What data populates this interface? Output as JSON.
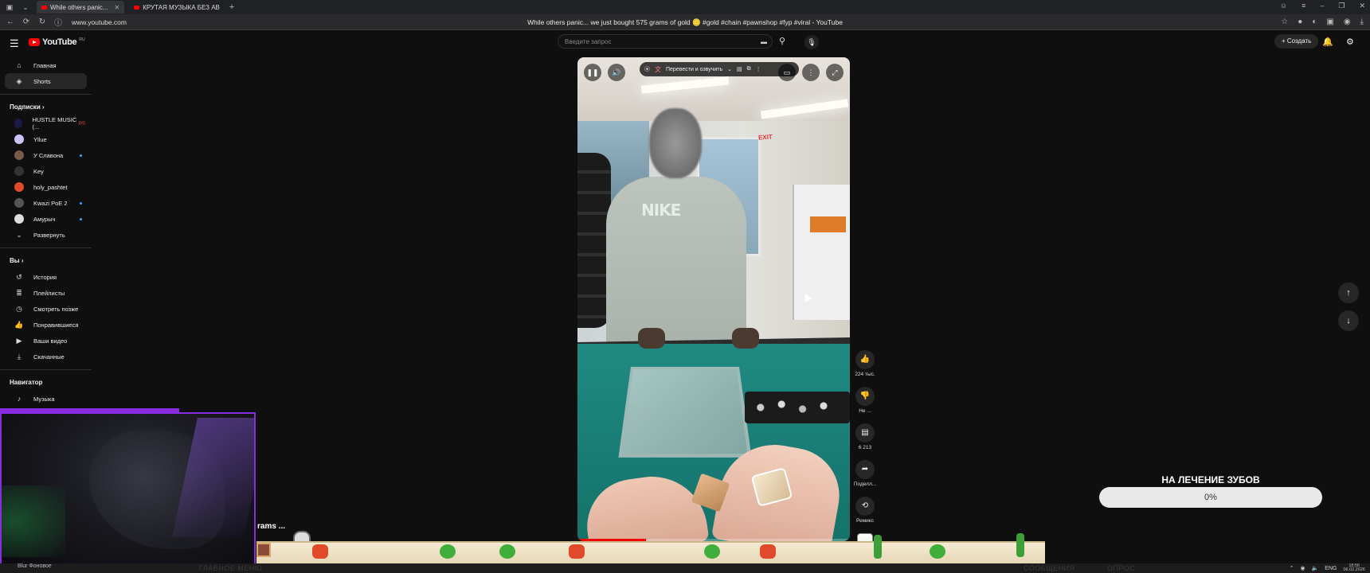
{
  "browser": {
    "tabs": [
      {
        "title": "While others panic...",
        "active": true
      },
      {
        "title": "КРУТАЯ МУЗЫКА БЕЗ АВ",
        "active": false
      }
    ],
    "url": "www.youtube.com",
    "page_title": "While others panic... we just bought 575 grams of gold 🪙 #gold #chain #pawnshop #fyp #viral - YouTube"
  },
  "header": {
    "logo_text": "YouTube",
    "logo_country": "RU",
    "search_placeholder": "Введите запрос",
    "create_label": "Создать"
  },
  "sidebar": {
    "main": [
      {
        "label": "Главная",
        "icon": "home-icon"
      },
      {
        "label": "Shorts",
        "icon": "shorts-icon",
        "active": true
      }
    ],
    "subscriptions_title": "Подписки",
    "subscriptions": [
      {
        "label": "HUSTLE MUSIC (...",
        "color": "#1a1a4a",
        "live": true
      },
      {
        "label": "Yllue",
        "color": "#cdc3ff"
      },
      {
        "label": "У Славона",
        "color": "#7a5a4a",
        "dot": true
      },
      {
        "label": "Key",
        "color": "#333333"
      },
      {
        "label": "holy_pashtet",
        "color": "#e04a2a"
      },
      {
        "label": "Kwazi PoE 2",
        "color": "#555555",
        "dot": true
      },
      {
        "label": "Амурыч",
        "color": "#dddddd",
        "dot": true
      }
    ],
    "expand_label": "Развернуть",
    "you_title": "Вы",
    "you": [
      {
        "label": "История",
        "icon": "history-icon"
      },
      {
        "label": "Плейлисты",
        "icon": "playlists-icon"
      },
      {
        "label": "Смотреть позже",
        "icon": "watch-later-icon"
      },
      {
        "label": "Понравившиеся",
        "icon": "like-icon"
      },
      {
        "label": "Ваши видео",
        "icon": "your-videos-icon"
      },
      {
        "label": "Скачанные",
        "icon": "download-icon"
      }
    ],
    "navigator_title": "Навигатор",
    "navigator": [
      {
        "label": "Музыка",
        "icon": "music-icon"
      }
    ]
  },
  "player": {
    "translate_label": "Перевести и озвучить",
    "progress_fraction": 0.25,
    "scene_text": {
      "shirt": "NIKE",
      "exit_sign": "EXIT"
    }
  },
  "actions": [
    {
      "name": "like",
      "icon": "thumbs-up-icon",
      "label": "224 тыс."
    },
    {
      "name": "dislike",
      "icon": "thumbs-down-icon",
      "label": "Не ..."
    },
    {
      "name": "comments",
      "icon": "comment-icon",
      "label": "6 213"
    },
    {
      "name": "share",
      "icon": "share-icon",
      "label": "Поделл..."
    },
    {
      "name": "remix",
      "icon": "remix-icon",
      "label": "Ремикс"
    }
  ],
  "goal": {
    "title": "НА ЛЕЧЕНИЕ ЗУБОВ",
    "percent_label": "0%",
    "fraction": 0
  },
  "overlay": {
    "ticker_text": "rams ...",
    "ghost_items": [
      "ГЛАВНОЕ МЕНЮ",
      "СООБЩЕНИЯ",
      "ОПРОС"
    ]
  },
  "taskbar": {
    "lang": "ENG",
    "time": "18:56",
    "date": "06.02.2026",
    "cam_label": "Blur Фоновое"
  }
}
